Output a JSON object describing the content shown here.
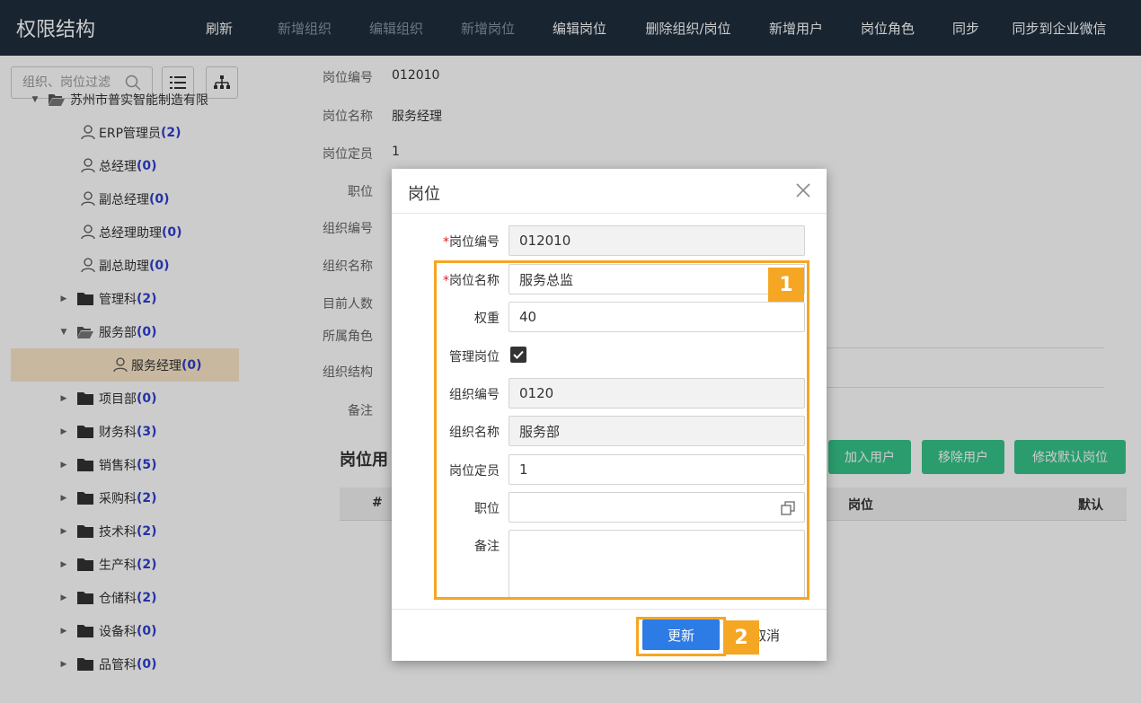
{
  "app": {
    "title": "权限结构"
  },
  "toolbar": {
    "items": [
      {
        "label": "刷新",
        "enabled": true
      },
      {
        "label": "新增组织",
        "enabled": false
      },
      {
        "label": "编辑组织",
        "enabled": false
      },
      {
        "label": "新增岗位",
        "enabled": false
      },
      {
        "label": "编辑岗位",
        "enabled": true
      },
      {
        "label": "删除组织/岗位",
        "enabled": true
      },
      {
        "label": "新增用户",
        "enabled": true
      },
      {
        "label": "岗位角色",
        "enabled": true
      },
      {
        "label": "同步",
        "enabled": true
      },
      {
        "label": "同步到企业微信",
        "enabled": true
      }
    ]
  },
  "sidebar": {
    "search_placeholder": "组织、岗位过滤",
    "tree": [
      {
        "label": "苏州市普实智能制造有限",
        "count": "",
        "type": "folder-open",
        "caret": "down"
      },
      {
        "label": "ERP管理员",
        "count": "(2)",
        "type": "user"
      },
      {
        "label": "总经理",
        "count": "(0)",
        "type": "user"
      },
      {
        "label": "副总经理",
        "count": "(0)",
        "type": "user"
      },
      {
        "label": "总经理助理",
        "count": "(0)",
        "type": "user"
      },
      {
        "label": "副总助理",
        "count": "(0)",
        "type": "user"
      },
      {
        "label": "管理科",
        "count": "(2)",
        "type": "folder",
        "caret": "right"
      },
      {
        "label": "服务部",
        "count": "(0)",
        "type": "folder-open",
        "caret": "down"
      },
      {
        "label": "服务经理",
        "count": "(0)",
        "type": "user",
        "selected": true
      },
      {
        "label": "项目部",
        "count": "(0)",
        "type": "folder",
        "caret": "right"
      },
      {
        "label": "财务科",
        "count": "(3)",
        "type": "folder",
        "caret": "right"
      },
      {
        "label": "销售科",
        "count": "(5)",
        "type": "folder",
        "caret": "right"
      },
      {
        "label": "采购科",
        "count": "(2)",
        "type": "folder",
        "caret": "right"
      },
      {
        "label": "技术科",
        "count": "(2)",
        "type": "folder",
        "caret": "right"
      },
      {
        "label": "生产科",
        "count": "(2)",
        "type": "folder",
        "caret": "right"
      },
      {
        "label": "仓储科",
        "count": "(2)",
        "type": "folder",
        "caret": "right"
      },
      {
        "label": "设备科",
        "count": "(0)",
        "type": "folder",
        "caret": "right"
      },
      {
        "label": "品管科",
        "count": "(0)",
        "type": "folder",
        "caret": "right"
      }
    ]
  },
  "detail": {
    "fields": [
      {
        "label": "岗位编号",
        "value": "012010"
      },
      {
        "label": "岗位名称",
        "value": "服务经理"
      },
      {
        "label": "岗位定员",
        "value": "1"
      },
      {
        "label": "职位",
        "value": ""
      },
      {
        "label": "组织编号",
        "value": ""
      },
      {
        "label": "组织名称",
        "value": ""
      },
      {
        "label": "目前人数",
        "value": ""
      },
      {
        "label": "所属角色",
        "value": ""
      },
      {
        "label": "组织结构",
        "value": ""
      },
      {
        "label": "备注",
        "value": ""
      }
    ],
    "table_title": "岗位用",
    "buttons": {
      "add_user": "加入用户",
      "remove_user": "移除用户",
      "set_default": "修改默认岗位"
    },
    "columns": {
      "index": "#",
      "post": "岗位",
      "default": "默认"
    }
  },
  "modal": {
    "title": "岗位",
    "fields": {
      "code": {
        "label": "岗位编号",
        "value": "012010",
        "required": "*"
      },
      "name": {
        "label": "岗位名称",
        "value": "服务总监",
        "required": "*"
      },
      "weight": {
        "label": "权重",
        "value": "40"
      },
      "is_manager": {
        "label": "管理岗位",
        "checked": true
      },
      "org_code": {
        "label": "组织编号",
        "value": "0120"
      },
      "org_name": {
        "label": "组织名称",
        "value": "服务部"
      },
      "quota": {
        "label": "岗位定员",
        "value": "1"
      },
      "position": {
        "label": "职位",
        "value": ""
      },
      "remark": {
        "label": "备注",
        "value": ""
      }
    },
    "update_label": "更新",
    "cancel_label": "取消"
  },
  "annotations": {
    "badge1": "1",
    "badge2": "2"
  },
  "colors": {
    "topbar": "#1f2d3d",
    "accent_blue": "#2d7be5",
    "green": "#36c48a",
    "highlight": "#f5a623",
    "selected_row": "#fbe7c9"
  }
}
